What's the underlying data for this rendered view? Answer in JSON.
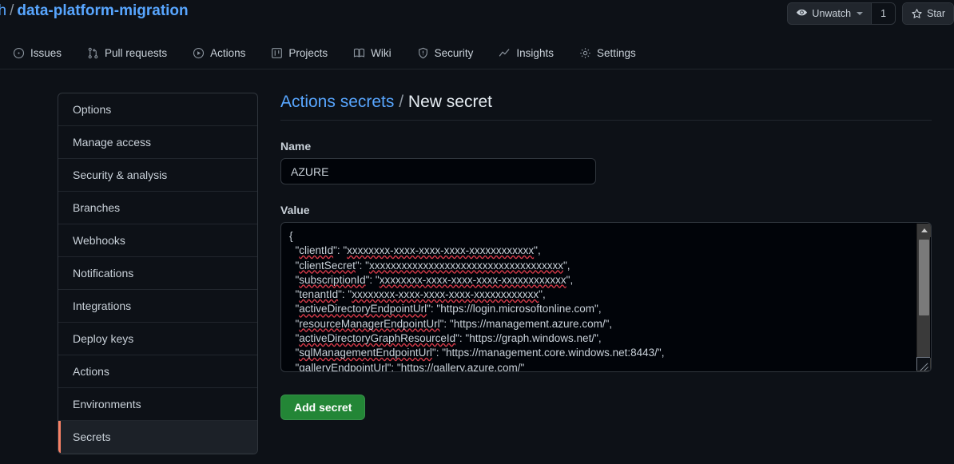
{
  "header": {
    "breadcrumb": {
      "owner": "ch",
      "separator": "/",
      "repo": "data-platform-migration"
    },
    "watch_button": {
      "icon": "eye-icon",
      "label": "Unwatch",
      "count": "1"
    },
    "star_button": {
      "icon": "star-icon",
      "label": "Star"
    }
  },
  "nav": {
    "tabs": [
      {
        "label": "Issues",
        "icon": "issue-opened-icon"
      },
      {
        "label": "Pull requests",
        "icon": "git-pull-request-icon"
      },
      {
        "label": "Actions",
        "icon": "play-icon"
      },
      {
        "label": "Projects",
        "icon": "project-icon"
      },
      {
        "label": "Wiki",
        "icon": "book-icon"
      },
      {
        "label": "Security",
        "icon": "shield-icon"
      },
      {
        "label": "Insights",
        "icon": "graph-icon"
      },
      {
        "label": "Settings",
        "icon": "gear-icon"
      }
    ]
  },
  "sidebar": {
    "items": [
      {
        "label": "Options",
        "selected": false
      },
      {
        "label": "Manage access",
        "selected": false
      },
      {
        "label": "Security & analysis",
        "selected": false
      },
      {
        "label": "Branches",
        "selected": false
      },
      {
        "label": "Webhooks",
        "selected": false
      },
      {
        "label": "Notifications",
        "selected": false
      },
      {
        "label": "Integrations",
        "selected": false
      },
      {
        "label": "Deploy keys",
        "selected": false
      },
      {
        "label": "Actions",
        "selected": false
      },
      {
        "label": "Environments",
        "selected": false
      },
      {
        "label": "Secrets",
        "selected": true
      }
    ],
    "selected_accent": "#f78166"
  },
  "main": {
    "title": {
      "link": "Actions secrets",
      "separator": "/",
      "current": "New secret"
    },
    "name_field": {
      "label": "Name",
      "value": "AZURE"
    },
    "value_field": {
      "label": "Value",
      "lines": [
        "{",
        "  \"clientId\": \"xxxxxxxx-xxxx-xxxx-xxxx-xxxxxxxxxxxx\",",
        "  \"clientSecret\": \"xxxxxxxxxxxxxxxxxxxxxxxxxxxxxxxxxxxx\",",
        "  \"subscriptionId\": \"xxxxxxxx-xxxx-xxxx-xxxx-xxxxxxxxxxxx\",",
        "  \"tenantId\": \"xxxxxxxx-xxxx-xxxx-xxxx-xxxxxxxxxxxx\",",
        "  \"activeDirectoryEndpointUrl\": \"https://login.microsoftonline.com\",",
        "  \"resourceManagerEndpointUrl\": \"https://management.azure.com/\",",
        "  \"activeDirectoryGraphResourceId\": \"https://graph.windows.net/\",",
        "  \"sqlManagementEndpointUrl\": \"https://management.core.windows.net:8443/\",",
        "  \"galleryEndpointUrl\": \"https://gallery.azure.com/\""
      ]
    },
    "submit_button": {
      "label": "Add secret",
      "color": "#238636"
    }
  }
}
